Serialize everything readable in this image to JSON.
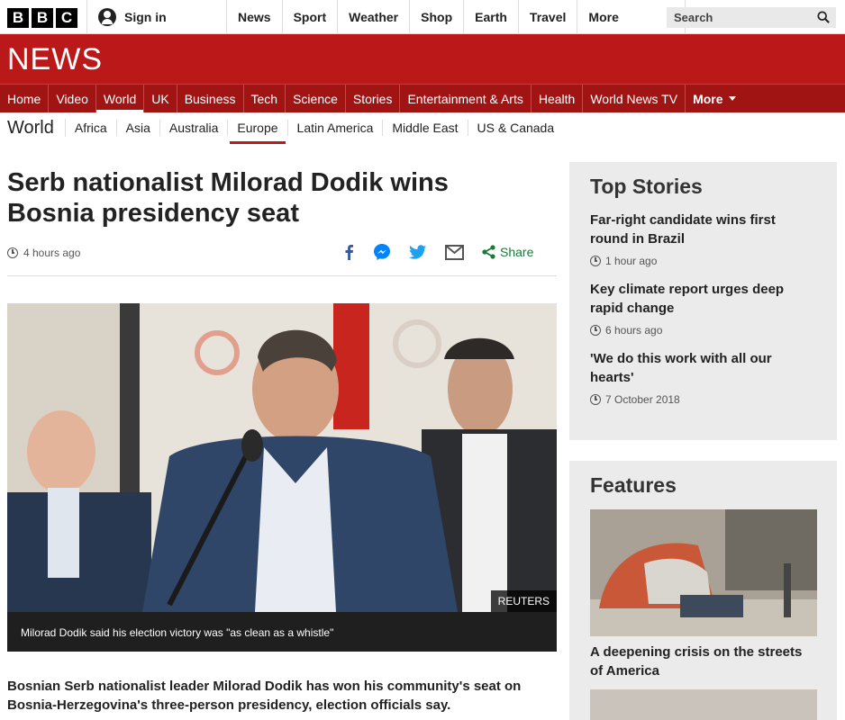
{
  "brand": {
    "logo_letters": [
      "B",
      "B",
      "C"
    ],
    "section_title": "NEWS",
    "brand_red": "#bb1919"
  },
  "topbar": {
    "signin_label": "Sign in",
    "nav": [
      "News",
      "Sport",
      "Weather",
      "Shop",
      "Earth",
      "Travel"
    ],
    "more_label": "More",
    "search_label": "Search"
  },
  "rednav": {
    "items": [
      "Home",
      "Video",
      "World",
      "UK",
      "Business",
      "Tech",
      "Science",
      "Stories",
      "Entertainment & Arts",
      "Health",
      "World News TV"
    ],
    "active": "World",
    "more_label": "More"
  },
  "subnav": {
    "title": "World",
    "items": [
      "Africa",
      "Asia",
      "Australia",
      "Europe",
      "Latin America",
      "Middle East",
      "US & Canada"
    ],
    "active": "Europe"
  },
  "article": {
    "headline": "Serb nationalist Milorad Dodik wins Bosnia presidency seat",
    "time": "4 hours ago",
    "share_label": "Share",
    "share_icons": [
      "facebook-icon",
      "messenger-icon",
      "twitter-icon",
      "email-icon",
      "share-icon"
    ],
    "photo_credit": "REUTERS",
    "caption": "Milorad Dodik said his election victory was \"as clean as a whistle\"",
    "lead": "Bosnian Serb nationalist leader Milorad Dodik has won his community's seat on Bosnia-Herzegovina's three-person presidency, election officials say."
  },
  "sidebar": {
    "top_stories_title": "Top Stories",
    "stories": [
      {
        "title": "Far-right candidate wins first round in Brazil",
        "time": "1 hour ago"
      },
      {
        "title": "Key climate report urges deep rapid change",
        "time": "6 hours ago"
      },
      {
        "title": "'We do this work with all our hearts'",
        "time": "7 October 2018"
      }
    ],
    "features_title": "Features",
    "feature": {
      "title": "A deepening crisis on the streets of America"
    }
  }
}
